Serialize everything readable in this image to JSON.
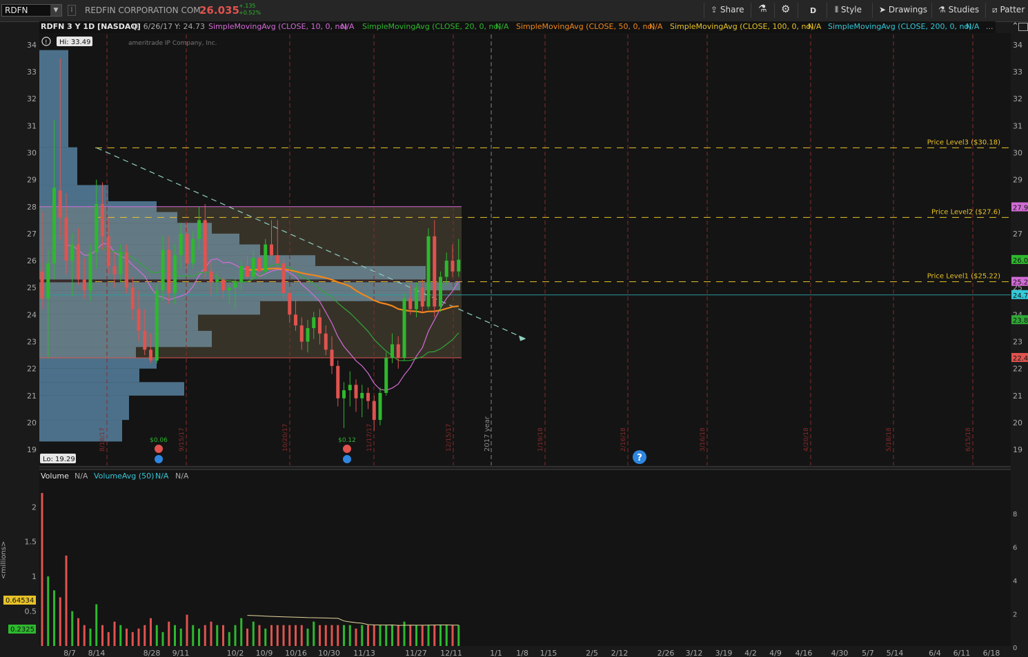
{
  "toolbar": {
    "symbol": "RDFN",
    "company": "REDFIN CORPORATION COM",
    "price": "26.035",
    "change_abs": "+.135",
    "change_pct": "+0.52%",
    "aggregation": "D",
    "share_label": "Share",
    "style_label": "Style",
    "drawings_label": "Drawings",
    "studies_label": "Studies",
    "patterns_label": "Patter"
  },
  "studies": {
    "title": "RDFN 3 Y 1D [NASDAQ]",
    "date": "D: 6/26/17",
    "yval": "Y: 24.73",
    "sma10": "SimpleMovingAvg (CLOSE, 10, 0, no)",
    "sma20": "SimpleMovingAvg (CLOSE, 20, 0, no)",
    "sma50": "SimpleMovingAvg (CLOSE, 50, 0, no)",
    "sma100": "SimpleMovingAvg (CLOSE, 100, 0, no)",
    "sma200": "SimpleMovingAvg (CLOSE, 200, 0, no)",
    "na": "N/A",
    "more": "..."
  },
  "colors": {
    "sma10": "#d36bd7",
    "sma20": "#2fa836",
    "sma50": "#f0861c",
    "sma100": "#e8c328",
    "sma200": "#35c8d8",
    "up": "#2eb82e",
    "down": "#e0534f"
  },
  "watermark": "ameritrade IP Company, Inc.",
  "chart_data": {
    "type": "candlestick",
    "ylim": [
      18.8,
      34.2
    ],
    "y_ticks": [
      "34",
      "33",
      "32",
      "31",
      "30",
      "29",
      "28",
      "27",
      "26",
      "25",
      "24",
      "23",
      "22",
      "21",
      "20",
      "19"
    ],
    "hi_label": "Hi: 33.49",
    "lo_label": "Lo: 19.29",
    "price_levels": [
      {
        "name": "Price Level3 ($30.18)",
        "value": 30.18
      },
      {
        "name": "Price Level2 ($27.6)",
        "value": 27.6
      },
      {
        "name": "Price Level1 ($25.22)",
        "value": 25.22
      }
    ],
    "right_tags": [
      {
        "text": "27.9",
        "value": 27.98,
        "color": "#d36bd7"
      },
      {
        "text": "26.0",
        "value": 26.03,
        "color": "#2eb82e"
      },
      {
        "text": "25.2",
        "value": 25.22,
        "color": "#d36bd7"
      },
      {
        "text": "24.7",
        "value": 24.73,
        "color": "#35c8d8"
      },
      {
        "text": "23.8",
        "value": 23.8,
        "color": "#2fa836"
      },
      {
        "text": "22.4",
        "value": 22.4,
        "color": "#e0534f"
      }
    ],
    "vertical_date_labels": [
      "8/18/17",
      "9/15/17",
      "10/20/17",
      "11/17/17",
      "12/15/17",
      "1/19/18",
      "2/16/18",
      "3/16/18",
      "4/20/18",
      "5/18/18",
      "6/15/18"
    ],
    "year_label": "2017 year",
    "events": [
      {
        "label": "$0.06",
        "date": "9/1/17"
      },
      {
        "label": "$0.12",
        "date": "11/8/17"
      }
    ],
    "x_ticks": [
      "8/7",
      "8/14",
      "8/28",
      "9/11",
      "10/2",
      "10/9",
      "10/16",
      "10/30",
      "11/13",
      "11/27",
      "12/11",
      "1/1",
      "1/8",
      "1/15",
      "2/5",
      "2/12",
      "2/26",
      "3/12",
      "3/19",
      "4/2",
      "4/9",
      "4/16",
      "4/30",
      "5/7",
      "5/14",
      "6/4",
      "6/11",
      "6/18"
    ],
    "candles": [
      [
        25.6,
        27.8,
        24.2,
        24.6
      ],
      [
        24.6,
        26.4,
        22.4,
        25.9
      ],
      [
        25.9,
        31.2,
        25.3,
        28.7
      ],
      [
        28.6,
        33.49,
        26.8,
        27.6
      ],
      [
        27.6,
        28.5,
        25.5,
        26.0
      ],
      [
        26.0,
        27.0,
        24.7,
        26.6
      ],
      [
        26.6,
        27.2,
        25.1,
        25.3
      ],
      [
        25.3,
        26.1,
        24.6,
        24.9
      ],
      [
        24.9,
        26.6,
        24.5,
        26.3
      ],
      [
        26.3,
        29.0,
        25.7,
        28.1
      ],
      [
        28.1,
        28.9,
        26.4,
        26.9
      ],
      [
        26.9,
        27.6,
        25.5,
        25.8
      ],
      [
        25.8,
        26.3,
        25.0,
        25.5
      ],
      [
        25.5,
        26.6,
        25.2,
        26.3
      ],
      [
        26.3,
        26.6,
        24.8,
        25.0
      ],
      [
        25.0,
        25.4,
        23.8,
        24.2
      ],
      [
        24.2,
        24.9,
        23.0,
        23.4
      ],
      [
        23.4,
        24.2,
        22.5,
        22.7
      ],
      [
        22.7,
        23.3,
        22.2,
        22.3
      ],
      [
        22.3,
        25.1,
        22.2,
        24.9
      ],
      [
        24.9,
        26.9,
        24.5,
        26.4
      ],
      [
        26.4,
        26.9,
        24.4,
        24.8
      ],
      [
        24.8,
        26.6,
        24.4,
        26.2
      ],
      [
        26.2,
        27.4,
        25.7,
        27.0
      ],
      [
        27.0,
        27.4,
        25.7,
        25.9
      ],
      [
        25.9,
        27.1,
        25.7,
        26.8
      ],
      [
        26.8,
        28.0,
        26.4,
        27.5
      ],
      [
        27.5,
        28.1,
        25.3,
        25.6
      ],
      [
        25.6,
        26.0,
        24.7,
        25.2
      ],
      [
        25.2,
        25.5,
        24.8,
        25.3
      ],
      [
        25.3,
        25.4,
        24.6,
        24.9
      ],
      [
        24.9,
        25.2,
        24.4,
        25.0
      ],
      [
        25.0,
        25.4,
        24.2,
        25.2
      ],
      [
        25.2,
        26.0,
        24.9,
        25.8
      ],
      [
        25.8,
        26.2,
        25.3,
        25.4
      ],
      [
        25.4,
        26.4,
        25.3,
        26.1
      ],
      [
        26.1,
        26.2,
        25.4,
        25.6
      ],
      [
        25.6,
        26.8,
        25.4,
        26.6
      ],
      [
        26.6,
        27.5,
        26.0,
        26.2
      ],
      [
        26.2,
        27.5,
        25.8,
        25.9
      ],
      [
        25.9,
        26.1,
        24.6,
        24.8
      ],
      [
        24.8,
        25.0,
        23.7,
        24.0
      ],
      [
        24.0,
        24.6,
        23.4,
        23.6
      ],
      [
        23.6,
        23.9,
        22.7,
        23.0
      ],
      [
        23.0,
        23.8,
        22.6,
        23.5
      ],
      [
        23.5,
        24.1,
        23.1,
        23.9
      ],
      [
        23.9,
        24.2,
        22.9,
        23.3
      ],
      [
        23.3,
        23.6,
        22.5,
        22.7
      ],
      [
        22.7,
        23.2,
        21.8,
        22.1
      ],
      [
        22.1,
        22.3,
        20.6,
        20.9
      ],
      [
        20.9,
        21.5,
        19.8,
        21.2
      ],
      [
        21.2,
        21.9,
        20.6,
        21.4
      ],
      [
        21.4,
        21.6,
        20.4,
        20.9
      ],
      [
        20.9,
        21.4,
        20.2,
        21.1
      ],
      [
        21.1,
        21.3,
        20.5,
        20.8
      ],
      [
        20.8,
        21.0,
        19.7,
        20.1
      ],
      [
        20.1,
        21.3,
        19.9,
        21.1
      ],
      [
        21.1,
        22.6,
        21.0,
        22.4
      ],
      [
        22.4,
        23.3,
        22.2,
        22.9
      ],
      [
        22.9,
        23.2,
        22.0,
        22.4
      ],
      [
        22.4,
        24.8,
        22.3,
        24.6
      ],
      [
        24.6,
        25.1,
        24.0,
        24.2
      ],
      [
        24.2,
        25.2,
        23.9,
        25.0
      ],
      [
        25.0,
        25.3,
        24.1,
        24.3
      ],
      [
        24.3,
        27.2,
        24.2,
        26.9
      ],
      [
        26.9,
        27.5,
        23.9,
        24.3
      ],
      [
        24.3,
        25.6,
        24.1,
        25.4
      ],
      [
        25.4,
        26.3,
        25.1,
        26.0
      ],
      [
        26.0,
        26.6,
        25.4,
        25.6
      ],
      [
        25.6,
        26.8,
        25.4,
        26.035
      ]
    ],
    "volume": {
      "ylim": [
        0,
        2.3
      ],
      "y_ticks_left": [
        "2",
        "1.5",
        "1",
        "0.5"
      ],
      "y_ticks_right": [
        "8",
        "6",
        "4",
        "2",
        "0"
      ],
      "current_tag": "0.64534",
      "avg_tag": "0.2325",
      "unit_label": "<millions>",
      "values": [
        2.2,
        1.0,
        0.8,
        0.7,
        1.3,
        0.5,
        0.4,
        0.3,
        0.25,
        0.6,
        0.3,
        0.2,
        0.35,
        0.3,
        0.25,
        0.2,
        0.25,
        0.3,
        0.4,
        0.3,
        0.2,
        0.35,
        0.3,
        0.25,
        0.45,
        0.3,
        0.25,
        0.3,
        0.35,
        0.3,
        0.3,
        0.2,
        0.3,
        0.4,
        0.25,
        0.35,
        0.3,
        0.25,
        0.3,
        0.3,
        0.3,
        0.3,
        0.3,
        0.3,
        0.25,
        0.35,
        0.3,
        0.3,
        0.3,
        0.3,
        0.3,
        0.3,
        0.25,
        0.3,
        0.3,
        0.3,
        0.3,
        0.3,
        0.3,
        0.3,
        0.35,
        0.3,
        0.3,
        0.3,
        0.3,
        0.3,
        0.3,
        0.3,
        0.3,
        0.3
      ],
      "avg": {
        "name": "VolumeAvg (50)"
      },
      "label": "Volume"
    }
  }
}
